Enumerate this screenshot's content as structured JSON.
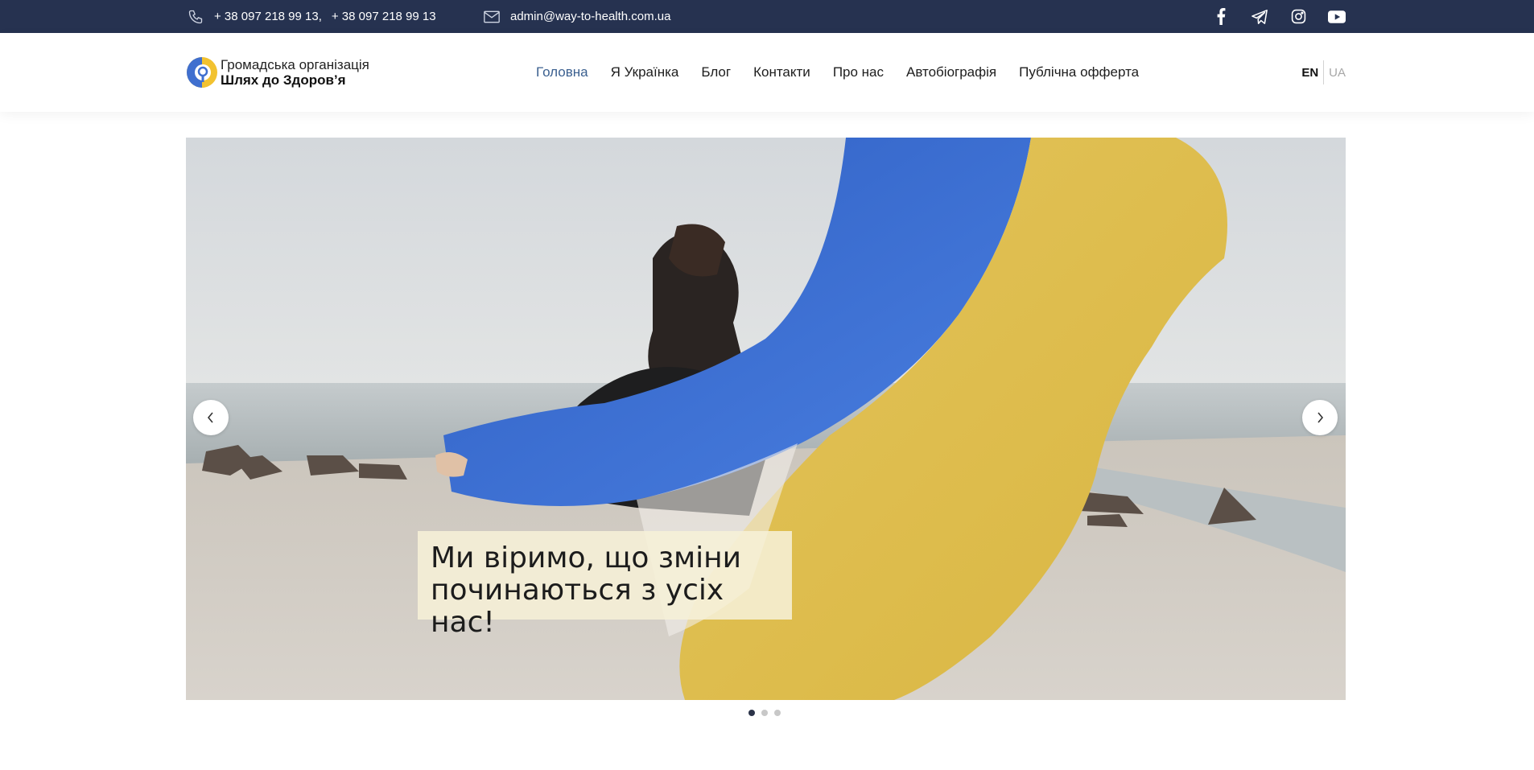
{
  "topbar": {
    "phone1": "+ 38 097 218 99 13,",
    "phone2": "+ 38 097 218 99 13",
    "email": "admin@way-to-health.com.ua",
    "social": [
      "facebook-icon",
      "telegram-icon",
      "instagram-icon",
      "youtube-icon"
    ],
    "bg_color": "#263250"
  },
  "header": {
    "logo_line1": "Громадська організація",
    "logo_line2": "Шлях до Здоров’я",
    "nav": [
      {
        "label": "Головна",
        "active": true
      },
      {
        "label": "Я Українка"
      },
      {
        "label": "Блог"
      },
      {
        "label": "Контакти"
      },
      {
        "label": "Про нас"
      },
      {
        "label": "Автобіографія"
      },
      {
        "label": "Публічна офферта"
      }
    ],
    "lang_en": "EN",
    "lang_ua": "UA",
    "accent_color": "#3a5f8f"
  },
  "hero": {
    "caption": "Ми віримо, що зміни починаються з усіх нас!",
    "slides_count": 3,
    "active_slide": 1,
    "flag_colors": [
      "#3f6fcf",
      "#e6c24a"
    ]
  }
}
